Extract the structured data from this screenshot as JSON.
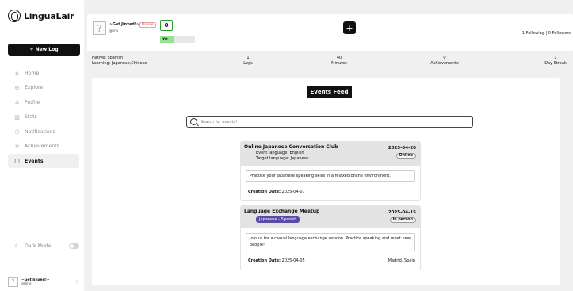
{
  "app": {
    "name": "LinguaLair",
    "new_log_label": "+ New Log"
  },
  "sidebar": {
    "items": [
      {
        "label": "Home",
        "icon": "home-icon",
        "active": false
      },
      {
        "label": "Explore",
        "icon": "explore-icon",
        "active": false
      },
      {
        "label": "Profile",
        "icon": "profile-icon",
        "active": false
      },
      {
        "label": "Stats",
        "icon": "stats-icon",
        "active": false
      },
      {
        "label": "Notifications",
        "icon": "bell-icon",
        "active": false
      },
      {
        "label": "Achievements",
        "icon": "trophy-icon",
        "active": false
      },
      {
        "label": "Events",
        "icon": "calendar-icon",
        "active": true
      }
    ],
    "dark_mode_label": "Dark Mode",
    "footer_user_name": "~Get Jinxed!~",
    "footer_user_handle": "@Jinx"
  },
  "profile": {
    "name": "~Get Jinxed!~",
    "handle": "@Jinx",
    "level_badge": "Novice",
    "xp_value": "0",
    "xp_label": "XP:",
    "xp_progress": 0.4,
    "following_text": "1 Following | 0 Followers"
  },
  "stats": {
    "native": "Native: Spanish",
    "learning": "Learning: Japanese,Chinese",
    "logs_value": "1",
    "logs_label": "Logs",
    "minutes_value": "40",
    "minutes_label": "Minutes",
    "achievements_value": "0",
    "achievements_label": "Achievements",
    "streak_value": "1",
    "streak_label": "Day Streak"
  },
  "feed": {
    "title": "Events Feed",
    "search_placeholder": "Search for events!",
    "events": [
      {
        "title": "Online Japanese Conversation Club",
        "event_language": "Event language: English",
        "target_language": "Target language: Japanese",
        "date": "2025-04-20",
        "mode": "Online",
        "description": "Practice your Japanese speaking skills in a relaxed online environment.",
        "creation_label": "Creation Date:",
        "creation_date": "2025-04-07"
      },
      {
        "title": "Language Exchange Meetup",
        "tag": "Japanese - Spanish",
        "date": "2025-04-15",
        "mode": "In person",
        "description": "Join us for a casual language exchange session. Practice speaking and meet new people!",
        "creation_label": "Creation Date:",
        "creation_date": "2025-04-05",
        "location": "Madrid, Spain"
      }
    ]
  },
  "colors": {
    "accent_dark": "#111111",
    "xp_green": "#95e48f",
    "novice_red": "#c84444",
    "tag_purple": "#5a4aa5"
  }
}
